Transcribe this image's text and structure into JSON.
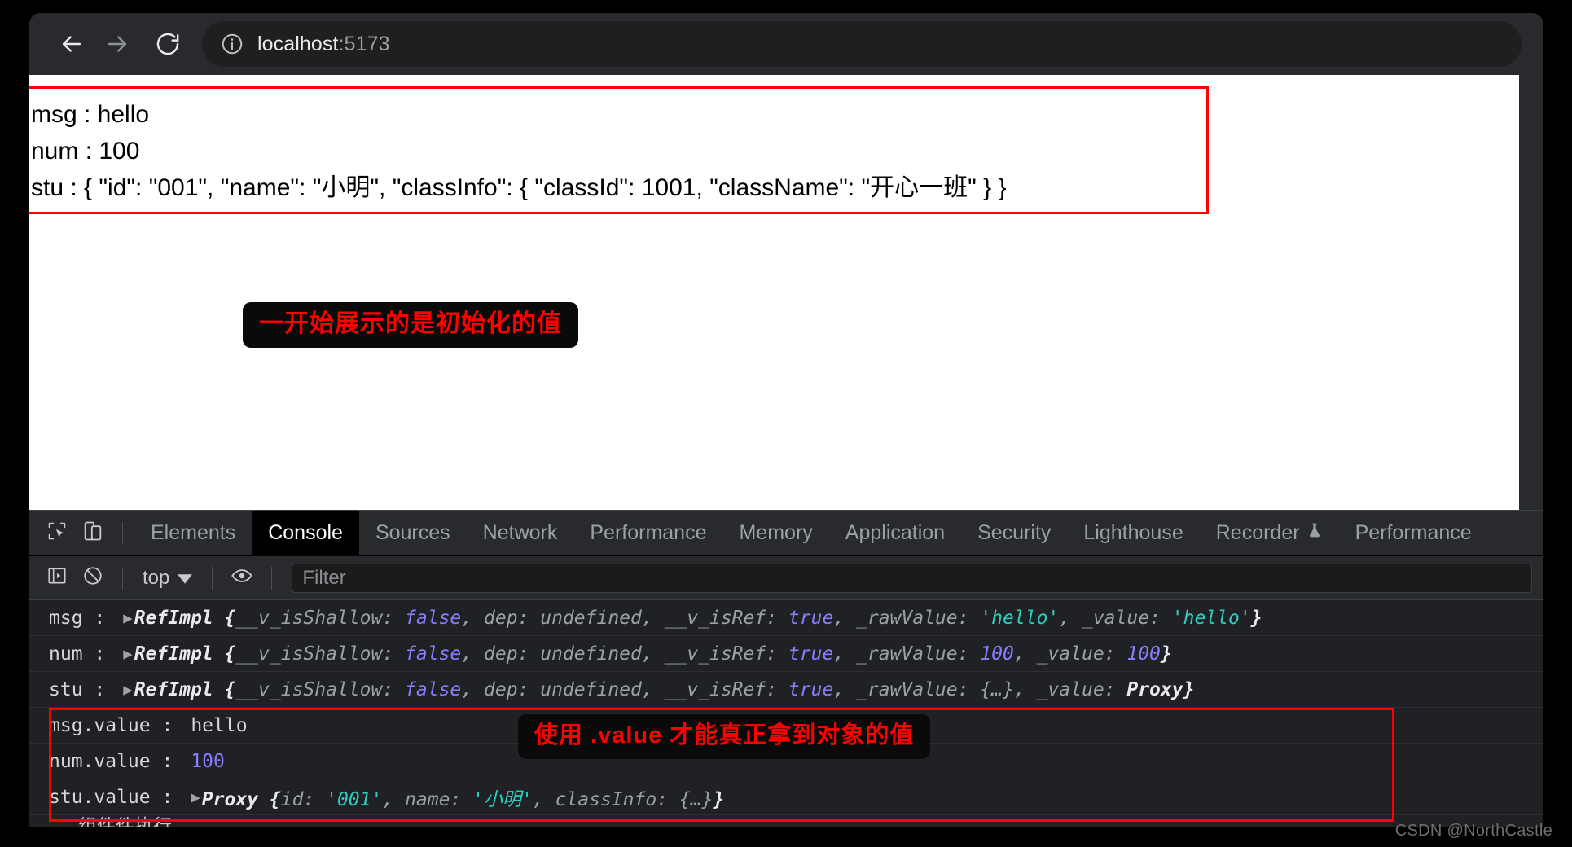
{
  "browser": {
    "back_icon": "arrow-left-icon",
    "forward_icon": "arrow-right-icon",
    "reload_icon": "reload-icon",
    "site_info_icon": "info-circle-icon",
    "url_host": "localhost",
    "url_port": ":5173",
    "url_full": "localhost:5173"
  },
  "page": {
    "lines": [
      "msg : hello",
      "num : 100",
      "stu : { \"id\": \"001\", \"name\": \"小明\", \"classInfo\": { \"classId\": 1001, \"className\": \"开心一班\" } }"
    ],
    "annotation": "一开始展示的是初始化的值",
    "outline_color": "#ff0000"
  },
  "devtools": {
    "inspect_icon": "inspect-cursor-icon",
    "device_toolbar_icon": "device-toggle-icon",
    "tabs": [
      {
        "label": "Elements",
        "active": false
      },
      {
        "label": "Console",
        "active": true
      },
      {
        "label": "Sources",
        "active": false
      },
      {
        "label": "Network",
        "active": false
      },
      {
        "label": "Performance",
        "active": false
      },
      {
        "label": "Memory",
        "active": false
      },
      {
        "label": "Application",
        "active": false
      },
      {
        "label": "Security",
        "active": false
      },
      {
        "label": "Lighthouse",
        "active": false
      },
      {
        "label": "Recorder",
        "active": false,
        "icon": "flask-icon"
      },
      {
        "label": "Performance",
        "active": false
      }
    ],
    "console_toolbar": {
      "sidebar_icon": "console-sidebar-icon",
      "clear_icon": "clear-console-icon",
      "context": "top",
      "context_caret": "chevron-down-icon",
      "eye_icon": "live-expression-eye-icon",
      "filter_placeholder": "Filter"
    },
    "annotation": "使用 .value 才能真正拿到对象的值",
    "outline_color": "#ff0000",
    "rows": [
      {
        "label": "msg :",
        "expander": "▶",
        "parts": [
          {
            "t": "RefImpl {",
            "c": "cls"
          },
          {
            "t": "__v_isShallow: ",
            "c": "key"
          },
          {
            "t": "false",
            "c": "bool"
          },
          {
            "t": ", ",
            "c": "key"
          },
          {
            "t": "dep: ",
            "c": "key"
          },
          {
            "t": "undefined",
            "c": "undef"
          },
          {
            "t": ", ",
            "c": "key"
          },
          {
            "t": "__v_isRef: ",
            "c": "key"
          },
          {
            "t": "true",
            "c": "bool"
          },
          {
            "t": ", ",
            "c": "key"
          },
          {
            "t": "_rawValue: ",
            "c": "key"
          },
          {
            "t": "'hello'",
            "c": "str"
          },
          {
            "t": ", ",
            "c": "key"
          },
          {
            "t": "_value: ",
            "c": "key"
          },
          {
            "t": "'hello'",
            "c": "str"
          },
          {
            "t": "}",
            "c": "cls"
          }
        ]
      },
      {
        "label": "num :",
        "expander": "▶",
        "parts": [
          {
            "t": "RefImpl {",
            "c": "cls"
          },
          {
            "t": "__v_isShallow: ",
            "c": "key"
          },
          {
            "t": "false",
            "c": "bool"
          },
          {
            "t": ", ",
            "c": "key"
          },
          {
            "t": "dep: ",
            "c": "key"
          },
          {
            "t": "undefined",
            "c": "undef"
          },
          {
            "t": ", ",
            "c": "key"
          },
          {
            "t": "__v_isRef: ",
            "c": "key"
          },
          {
            "t": "true",
            "c": "bool"
          },
          {
            "t": ", ",
            "c": "key"
          },
          {
            "t": "_rawValue: ",
            "c": "key"
          },
          {
            "t": "100",
            "c": "num"
          },
          {
            "t": ", ",
            "c": "key"
          },
          {
            "t": "_value: ",
            "c": "key"
          },
          {
            "t": "100",
            "c": "num"
          },
          {
            "t": "}",
            "c": "cls"
          }
        ]
      },
      {
        "label": "stu :",
        "expander": "▶",
        "parts": [
          {
            "t": "RefImpl {",
            "c": "cls"
          },
          {
            "t": "__v_isShallow: ",
            "c": "key"
          },
          {
            "t": "false",
            "c": "bool"
          },
          {
            "t": ", ",
            "c": "key"
          },
          {
            "t": "dep: ",
            "c": "key"
          },
          {
            "t": "undefined",
            "c": "undef"
          },
          {
            "t": ", ",
            "c": "key"
          },
          {
            "t": "__v_isRef: ",
            "c": "key"
          },
          {
            "t": "true",
            "c": "bool"
          },
          {
            "t": ", ",
            "c": "key"
          },
          {
            "t": "_rawValue: ",
            "c": "key"
          },
          {
            "t": "{…}",
            "c": "obj"
          },
          {
            "t": ", ",
            "c": "key"
          },
          {
            "t": "_value: ",
            "c": "key"
          },
          {
            "t": "Proxy",
            "c": "cls"
          },
          {
            "t": "}",
            "c": "cls"
          }
        ]
      },
      {
        "label": "msg.value :",
        "expander": "",
        "parts": [
          {
            "t": "hello",
            "c": "plaintext"
          }
        ]
      },
      {
        "label": "num.value :",
        "expander": "",
        "parts": [
          {
            "t": "100",
            "c": "plainnum"
          }
        ]
      },
      {
        "label": "stu.value :",
        "expander": "▶",
        "parts": [
          {
            "t": "Proxy {",
            "c": "cls"
          },
          {
            "t": "id: ",
            "c": "key"
          },
          {
            "t": "'001'",
            "c": "str"
          },
          {
            "t": ", ",
            "c": "key"
          },
          {
            "t": "name: ",
            "c": "key"
          },
          {
            "t": "'小明'",
            "c": "str"
          },
          {
            "t": ", ",
            "c": "key"
          },
          {
            "t": "classInfo: ",
            "c": "key"
          },
          {
            "t": "{…}",
            "c": "obj"
          },
          {
            "t": "}",
            "c": "cls"
          }
        ]
      }
    ],
    "clipped_row": "组件件执行"
  },
  "watermark": "CSDN @NorthCastle"
}
